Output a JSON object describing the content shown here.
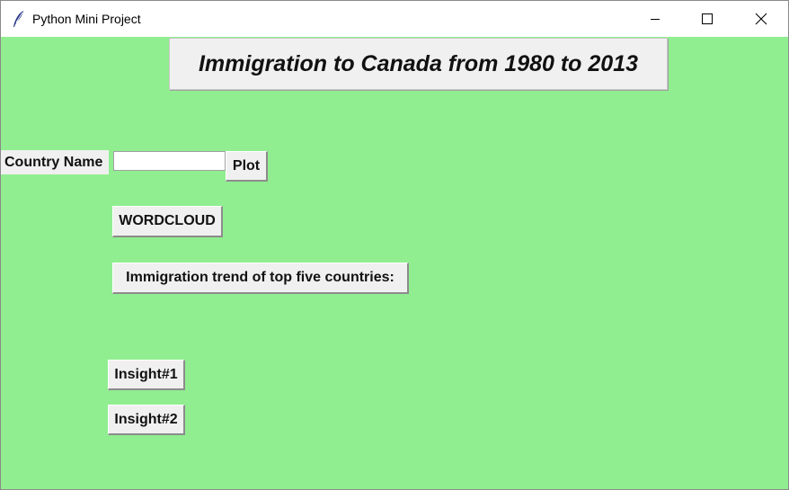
{
  "window": {
    "title": "Python Mini Project",
    "icon": "tk-feather-icon",
    "controls": [
      "minimize-icon",
      "maximize-icon",
      "close-icon"
    ]
  },
  "colors": {
    "client_background": "#90ee90",
    "widget_background": "#f0f0f0"
  },
  "main": {
    "heading": "Immigration to Canada from 1980 to 2013",
    "country_label": "Country Name",
    "country_input_value": "",
    "plot_button": "Plot",
    "wordcloud_button": "WORDCLOUD",
    "trend_button": "Immigration trend of top five countries:",
    "insight1_button": "Insight#1",
    "insight2_button": "Insight#2"
  }
}
